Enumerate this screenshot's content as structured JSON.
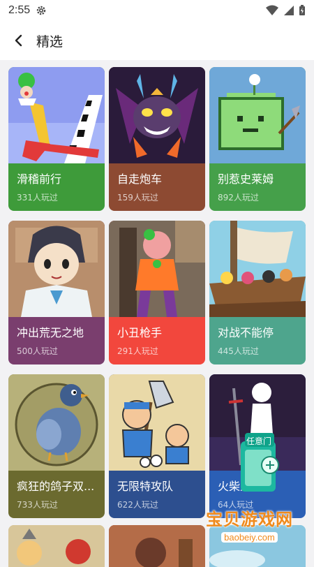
{
  "status": {
    "time": "2:55"
  },
  "header": {
    "title": "精选"
  },
  "colors": {
    "card_green": "#3e9b3a",
    "card_brown": "#8d4a32",
    "card_lime": "#45a04a",
    "card_purple": "#7a3e6e",
    "card_red": "#f2473d",
    "card_teal": "#4ea58d",
    "card_olive": "#6b6a2f",
    "card_navy": "#2d4f8f",
    "card_blue": "#2b5fb5"
  },
  "games": [
    {
      "name": "滑稽前行",
      "plays": "331人玩过",
      "color": "#3e9b3a"
    },
    {
      "name": "自走炮车",
      "plays": "159人玩过",
      "color": "#8d4a32"
    },
    {
      "name": "别惹史莱姆",
      "plays": "892人玩过",
      "color": "#45a04a"
    },
    {
      "name": "冲出荒无之地",
      "plays": "500人玩过",
      "color": "#7a3e6e"
    },
    {
      "name": "小丑枪手",
      "plays": "291人玩过",
      "color": "#f2473d"
    },
    {
      "name": "对战不能停",
      "plays": "445人玩过",
      "color": "#4ea58d"
    },
    {
      "name": "疯狂的鸽子双...",
      "plays": "733人玩过",
      "color": "#6b6a2f"
    },
    {
      "name": "无限特攻队",
      "plays": "622人玩过",
      "color": "#2d4f8f"
    },
    {
      "name": "火柴人大师",
      "plays": "64人玩过",
      "color": "#2b5fb5"
    }
  ],
  "overlay": {
    "badge_label": "任意门"
  },
  "watermark": {
    "main": "宝贝游戏网",
    "sub": "baobeiy.com"
  }
}
